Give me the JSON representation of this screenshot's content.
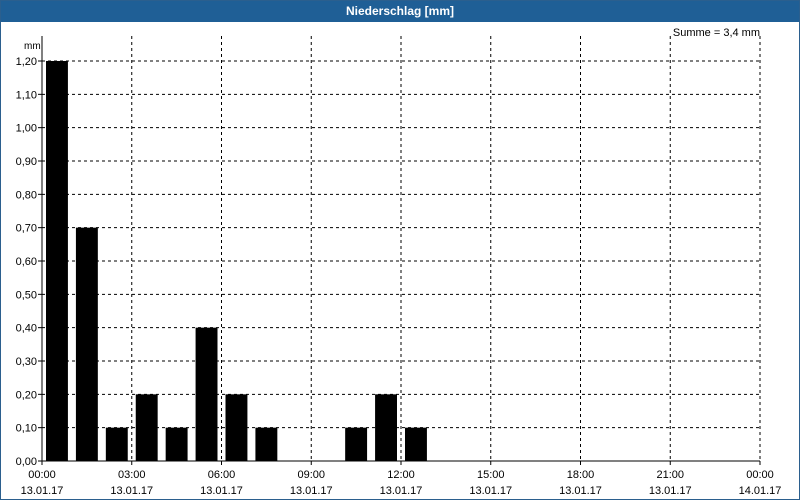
{
  "window": {
    "title": "Niederschlag [mm]"
  },
  "chart_data": {
    "type": "bar",
    "title": "Niederschlag [mm]",
    "ylabel": "mm",
    "xlabel": "",
    "annotation": "Summe = 3,4 mm",
    "ylim": [
      0,
      1.2
    ],
    "yticks": [
      "0,00",
      "0,10",
      "0,20",
      "0,30",
      "0,40",
      "0,50",
      "0,60",
      "0,70",
      "0,80",
      "0,90",
      "1,00",
      "1,10",
      "1,20"
    ],
    "xticks": [
      {
        "time": "00:00",
        "date": "13.01.17"
      },
      {
        "time": "03:00",
        "date": "13.01.17"
      },
      {
        "time": "06:00",
        "date": "13.01.17"
      },
      {
        "time": "09:00",
        "date": "13.01.17"
      },
      {
        "time": "12:00",
        "date": "13.01.17"
      },
      {
        "time": "15:00",
        "date": "13.01.17"
      },
      {
        "time": "18:00",
        "date": "13.01.17"
      },
      {
        "time": "21:00",
        "date": "13.01.17"
      },
      {
        "time": "00:00",
        "date": "14.01.17"
      }
    ],
    "x": [
      "00:00",
      "01:00",
      "02:00",
      "03:00",
      "04:00",
      "05:00",
      "06:00",
      "07:00",
      "08:00",
      "09:00",
      "10:00",
      "11:00",
      "12:00",
      "13:00",
      "14:00",
      "15:00",
      "16:00",
      "17:00",
      "18:00",
      "19:00",
      "20:00",
      "21:00",
      "22:00",
      "23:00"
    ],
    "values": [
      1.2,
      0.7,
      0.1,
      0.2,
      0.1,
      0.4,
      0.2,
      0.1,
      0,
      0,
      0.1,
      0.2,
      0.1,
      0,
      0,
      0,
      0,
      0,
      0,
      0,
      0,
      0,
      0,
      0
    ],
    "grid": true,
    "bar_color": "#000000",
    "grid_color": "#000000"
  }
}
